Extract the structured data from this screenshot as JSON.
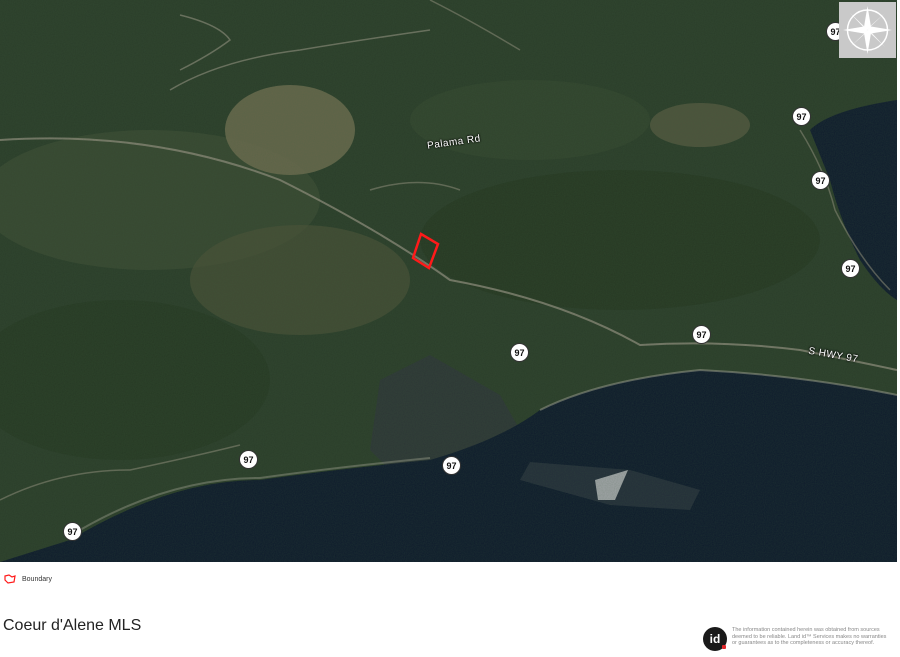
{
  "map": {
    "road_label_1": "Palama Rd",
    "road_label_2": "S HWY 97",
    "highway_shield": "97",
    "colors": {
      "forest": "#2b3d2a",
      "lake": "#0e1a2c",
      "parcel_outline": "#ff1a1a",
      "clearing": "#6a6a4e"
    },
    "compass_icon": "compass-rose-icon"
  },
  "legend": {
    "label": "Boundary",
    "icon": "boundary-outline-icon"
  },
  "footer": {
    "brand": "Coeur d'Alene MLS",
    "logo_text": "id",
    "disclaimer": "The information contained herein was obtained from sources deemed to be reliable. Land id™ Services makes no warranties or guarantees as to the completeness or accuracy thereof."
  }
}
